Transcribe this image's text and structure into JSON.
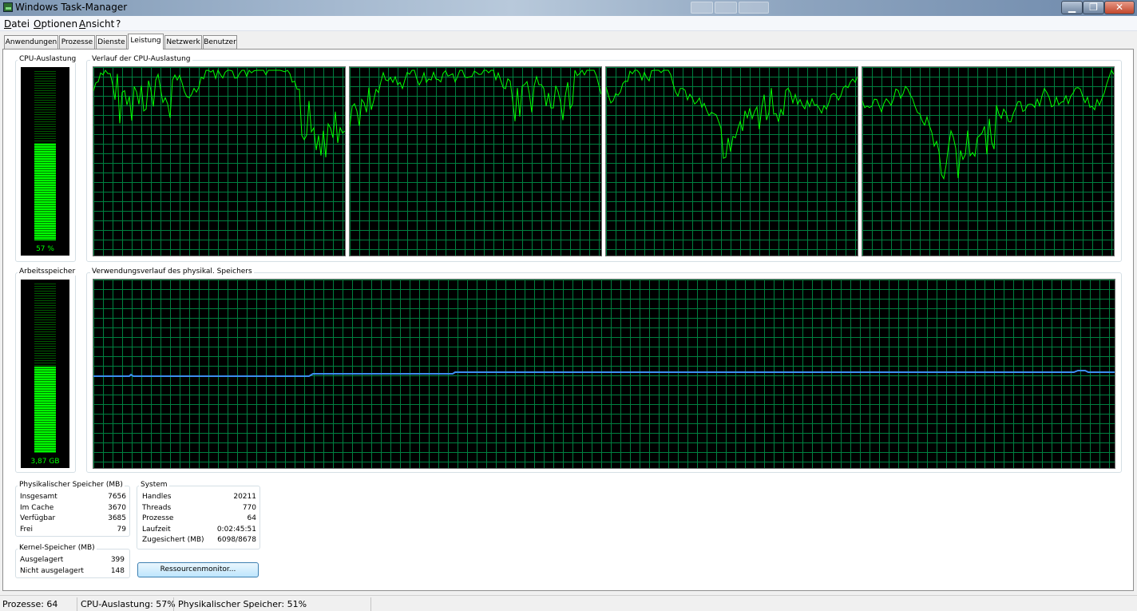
{
  "window": {
    "title": "Windows Task-Manager"
  },
  "menu": [
    "Datei",
    "Optionen",
    "Ansicht",
    "?"
  ],
  "tabs": [
    "Anwendungen",
    "Prozesse",
    "Dienste",
    "Leistung",
    "Netzwerk",
    "Benutzer"
  ],
  "active_tab": "Leistung",
  "cpu": {
    "label": "CPU-Auslastung",
    "value_text": "57 %",
    "usage_percent": 57,
    "history_label": "Verlauf der CPU-Auslastung",
    "cores": 4,
    "line_color": "#00ff00"
  },
  "memory": {
    "label": "Arbeitsspeicher",
    "value_text": "3,87 GB",
    "usage_percent": 51,
    "history_label": "Verwendungsverlauf des physikal. Speichers",
    "line_color": "#3b8df0"
  },
  "physical": {
    "title": "Physikalischer Speicher (MB)",
    "rows": [
      {
        "label": "Insgesamt",
        "value": "7656"
      },
      {
        "label": "Im Cache",
        "value": "3670"
      },
      {
        "label": "Verfügbar",
        "value": "3685"
      },
      {
        "label": "Frei",
        "value": "79"
      }
    ]
  },
  "kernel": {
    "title": "Kernel-Speicher (MB)",
    "rows": [
      {
        "label": "Ausgelagert",
        "value": "399"
      },
      {
        "label": "Nicht ausgelagert",
        "value": "148"
      }
    ]
  },
  "system": {
    "title": "System",
    "rows": [
      {
        "label": "Handles",
        "value": "20211"
      },
      {
        "label": "Threads",
        "value": "770"
      },
      {
        "label": "Prozesse",
        "value": "64"
      },
      {
        "label": "Laufzeit",
        "value": "0:02:45:51"
      },
      {
        "label": "Zugesichert (MB)",
        "value": "6098/8678"
      }
    ]
  },
  "resource_button": "Ressourcenmonitor...",
  "status": {
    "processes": "Prozesse: 64",
    "cpu": "CPU-Auslastung: 57%",
    "memory": "Physikalischer Speicher: 51%"
  }
}
